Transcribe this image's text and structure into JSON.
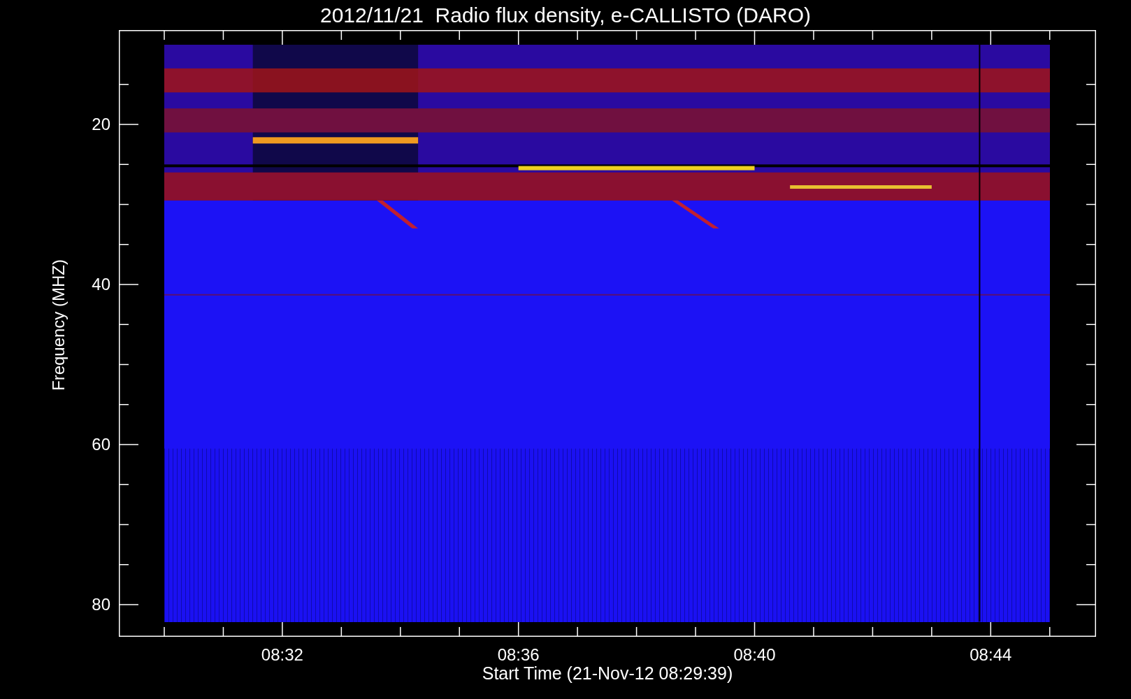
{
  "title": "2012/11/21  Radio flux density, e-CALLISTO (DARO)",
  "ylabel": "Frequency (MHZ)",
  "yticks": [
    "20",
    "40",
    "60",
    "80"
  ],
  "xticks": [
    "08:32",
    "08:36",
    "08:40",
    "08:44"
  ],
  "xlabel": "Start Time (21-Nov-12 08:29:39)"
}
